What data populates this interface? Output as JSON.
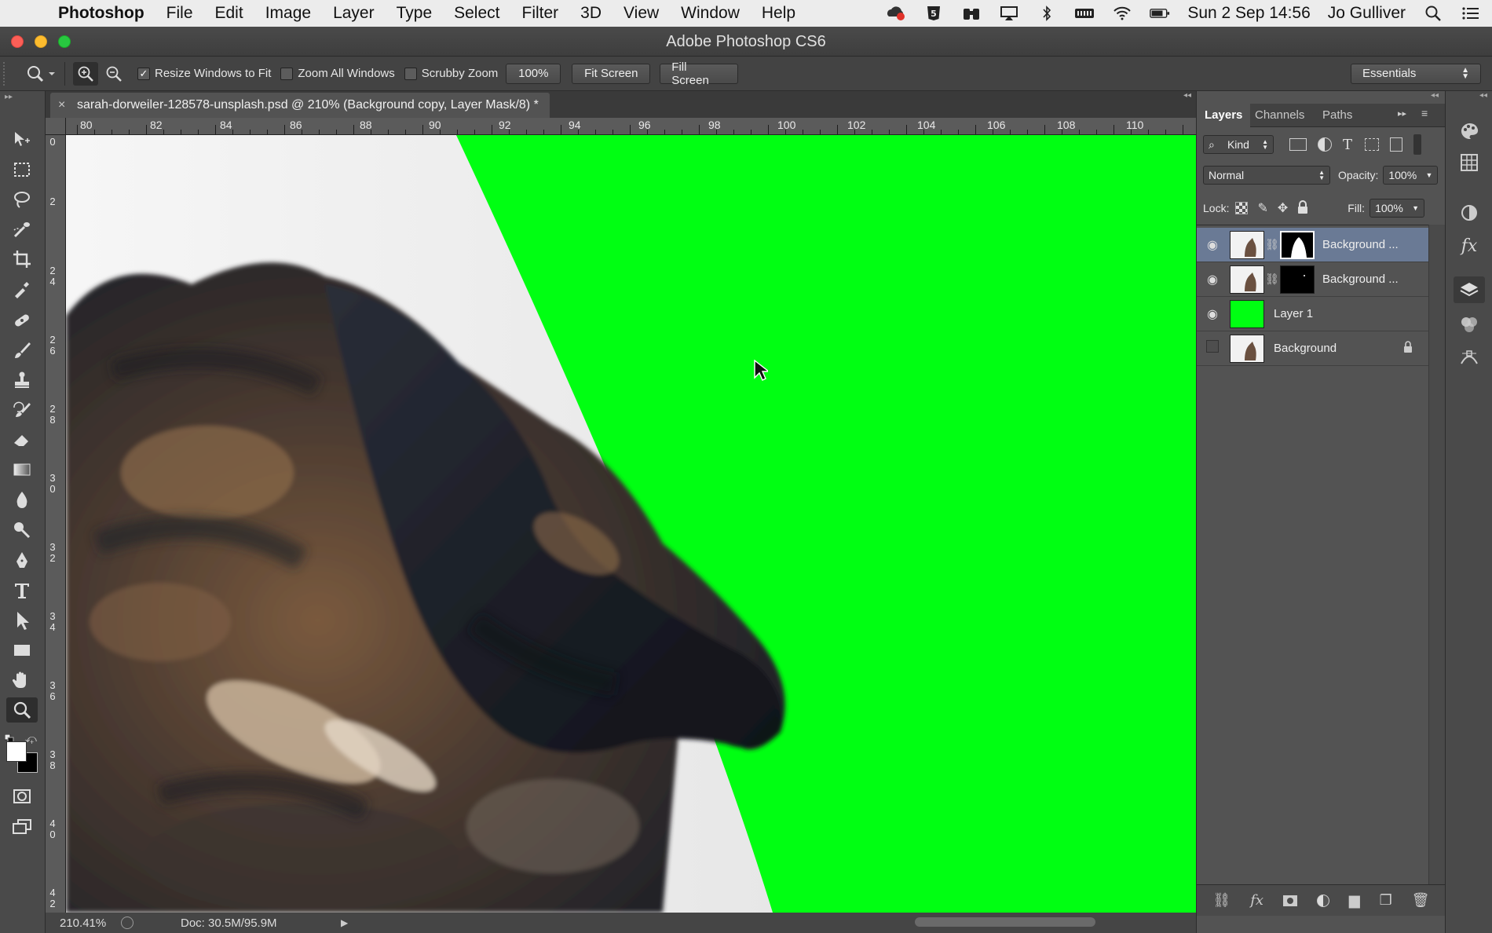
{
  "menubar": {
    "app_name": "Photoshop",
    "items": [
      "File",
      "Edit",
      "Image",
      "Layer",
      "Type",
      "Select",
      "Filter",
      "3D",
      "View",
      "Window",
      "Help"
    ],
    "datetime": "Sun 2 Sep  14:56",
    "user": "Jo Gulliver"
  },
  "window": {
    "title": "Adobe Photoshop CS6"
  },
  "options_bar": {
    "resize_windows_label": "Resize Windows to Fit",
    "zoom_all_label": "Zoom All Windows",
    "scrubby_zoom_label": "Scrubby Zoom",
    "zoom_value": "100%",
    "fit_screen_label": "Fit Screen",
    "fill_screen_label": "Fill Screen",
    "workspace": "Essentials"
  },
  "document": {
    "tab_title": "sarah-dorweiler-128578-unsplash.psd @ 210% (Background copy, Layer Mask/8) *",
    "ruler_top_labels": [
      "80",
      "82",
      "84",
      "86",
      "88",
      "90",
      "92",
      "94",
      "96",
      "98",
      "100",
      "102",
      "104",
      "106",
      "108",
      "110"
    ],
    "ruler_left_labels": [
      "0",
      "2",
      "2 4",
      "2 6",
      "2 8",
      "3 0",
      "3 2",
      "3 4",
      "3 6",
      "3 8",
      "4 0",
      "4 2"
    ],
    "zoom": "210.41%",
    "doc_info": "Doc: 30.5M/95.9M",
    "chroma_color": "#00ff12"
  },
  "layers_panel": {
    "tabs": [
      "Layers",
      "Channels",
      "Paths"
    ],
    "filter_kind": "Kind",
    "blend_mode": "Normal",
    "opacity_label": "Opacity:",
    "opacity_value": "100%",
    "lock_label": "Lock:",
    "fill_label": "Fill:",
    "fill_value": "100%",
    "layers": [
      {
        "name": "Background ...",
        "visible": true,
        "selected": true
      },
      {
        "name": "Background ...",
        "visible": true,
        "selected": false
      },
      {
        "name": "Layer 1",
        "visible": true,
        "selected": false
      },
      {
        "name": "Background",
        "visible": false,
        "selected": false
      }
    ]
  }
}
